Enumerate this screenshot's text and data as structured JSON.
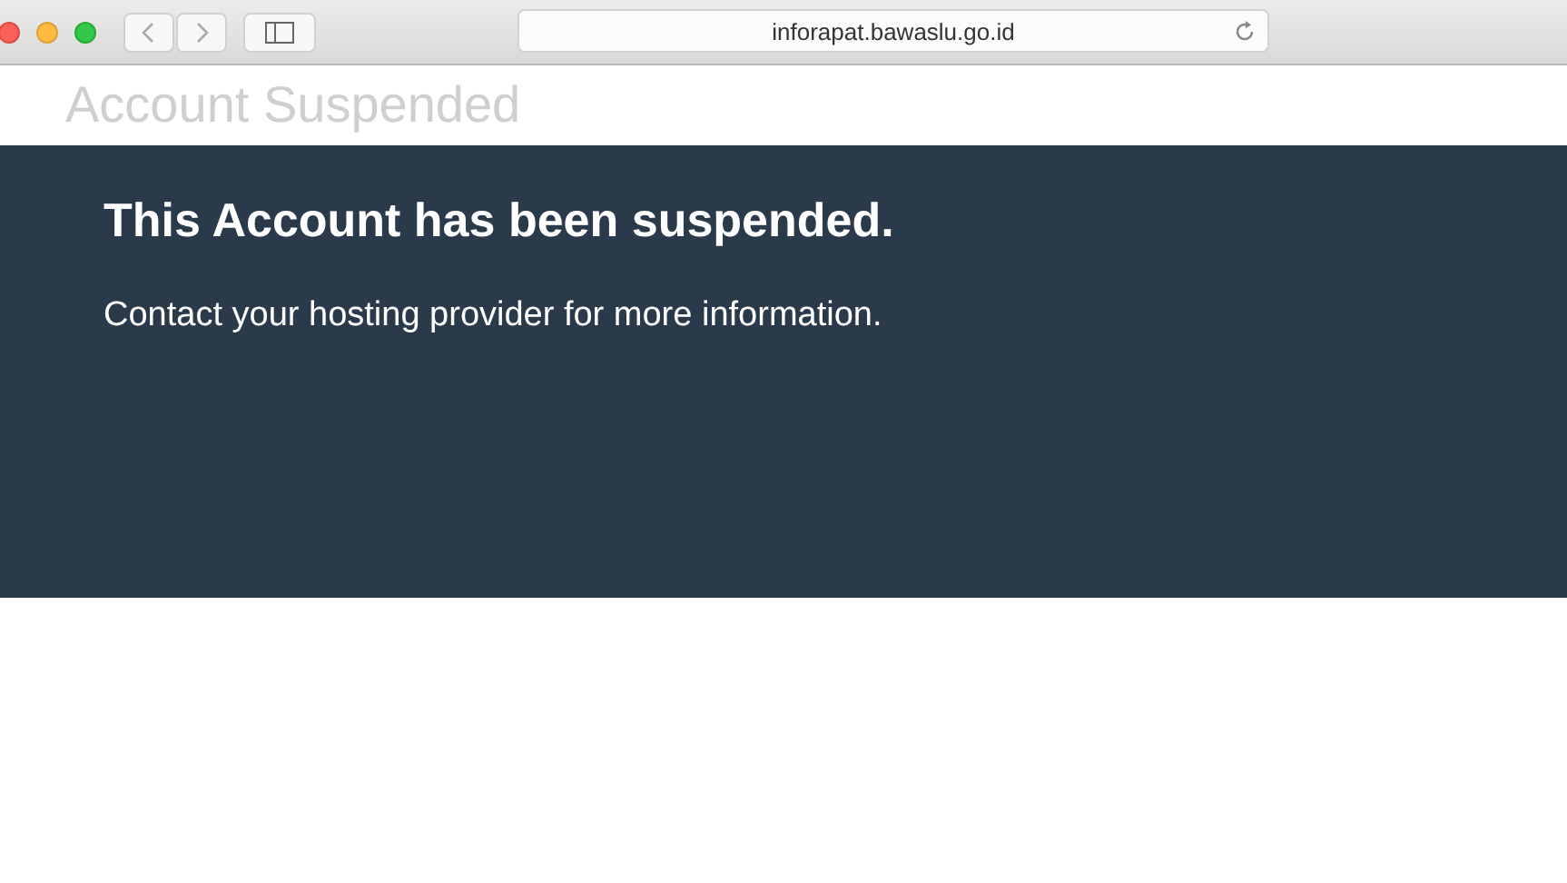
{
  "browser": {
    "address": "inforapat.bawaslu.go.id"
  },
  "page": {
    "title": "Account Suspended",
    "heading": "This Account has been suspended.",
    "message": "Contact your hosting provider for more information."
  }
}
